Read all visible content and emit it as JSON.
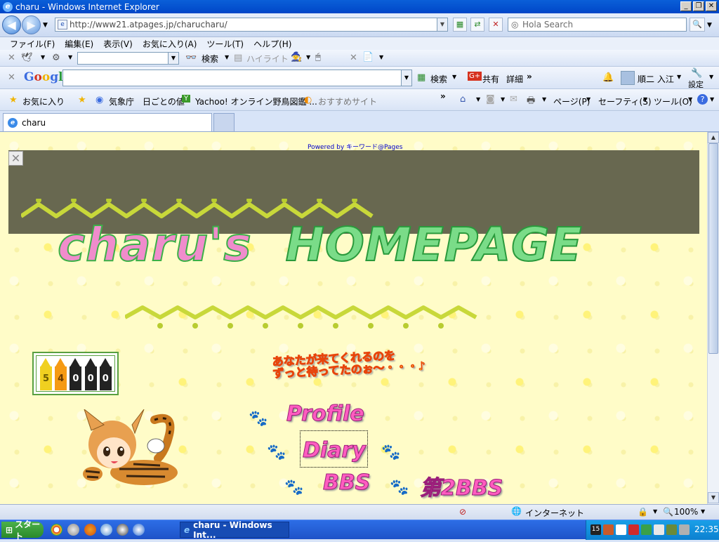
{
  "window": {
    "title": "charu - Windows Internet Explorer"
  },
  "nav": {
    "url": "http://www21.atpages.jp/charucharu/",
    "search_placeholder": "Hola Search"
  },
  "menu": [
    "ファイル(F)",
    "編集(E)",
    "表示(V)",
    "お気に入り(A)",
    "ツール(T)",
    "ヘルプ(H)"
  ],
  "toolbar1": {
    "search_label": "検索",
    "highlight_label": "ハイライト"
  },
  "google_bar": {
    "logo": "Google",
    "search_label": "検索",
    "share_label": "共有",
    "more_label": "詳細",
    "user_name": "順二 入江",
    "settings_label": "設定"
  },
  "favorites": {
    "favorites_label": "お気に入り",
    "links": [
      "気象庁　日ごとの値",
      "Yachoo! オンライン野鳥図鑑 ...",
      "おすすめサイト"
    ],
    "right_items": [
      "ページ(P)",
      "セーフティ(S)",
      "ツール(O)"
    ]
  },
  "tab": {
    "label": "charu"
  },
  "page": {
    "powered_by": "Powered by キーワード@Pages",
    "title_part1": "charu's",
    "title_part2": "HOMEPAGE",
    "counter_digits": [
      "5",
      "4",
      "0",
      "0",
      "0"
    ],
    "welcome_line1": "あなたが来てくれるのを",
    "welcome_line2": "ずっと待ってたのぉ〜・・・♪",
    "links": {
      "profile": "Profile",
      "diary": "Diary",
      "bbs": "BBS",
      "bbs2": "第2BBS"
    }
  },
  "status": {
    "zone": "インターネット",
    "zoom": "100%"
  },
  "taskbar": {
    "start_label": "スタート",
    "task_label": "charu - Windows Int...",
    "clock": "22:35"
  },
  "colors": {
    "page_bg": "#fffcc8",
    "ad_bg": "#686850",
    "link_pink": "#ff5cc0",
    "title_green": "#7adc88"
  },
  "crayon_colors": [
    "#f0d020",
    "#f59a14",
    "#1a1a1a",
    "#1a1a1a",
    "#1a1a1a"
  ]
}
